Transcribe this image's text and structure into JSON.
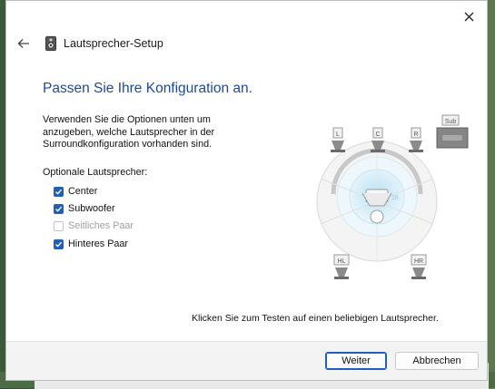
{
  "window": {
    "title": "Lautsprecher-Setup",
    "close_icon": "close-icon",
    "back_icon": "arrow-left-icon",
    "app_icon": "speaker-icon"
  },
  "main": {
    "heading": "Passen Sie Ihre Konfiguration an.",
    "intro_lines": [
      "Verwenden Sie die Optionen unten um",
      "anzugeben, welche Lautsprecher in der",
      "Surroundkonfiguration vorhanden sind."
    ],
    "optional_label": "Optionale Lautsprecher:",
    "options": [
      {
        "label": "Center",
        "checked": true,
        "enabled": true
      },
      {
        "label": "Subwoofer",
        "checked": true,
        "enabled": true
      },
      {
        "label": "Seitliches Paar",
        "checked": false,
        "enabled": false
      },
      {
        "label": "Hinteres Paar",
        "checked": true,
        "enabled": true
      }
    ],
    "speakers": {
      "left": "L",
      "center": "C",
      "right": "R",
      "sub": "Sub",
      "rear_left": "HL",
      "rear_right": "HR"
    },
    "hint": "Klicken Sie zum Testen auf einen beliebigen Lautsprecher."
  },
  "footer": {
    "next_label": "Weiter",
    "cancel_label": "Abbrechen"
  },
  "colors": {
    "accent": "#1f5fb8",
    "heading": "#1e4a9a"
  }
}
